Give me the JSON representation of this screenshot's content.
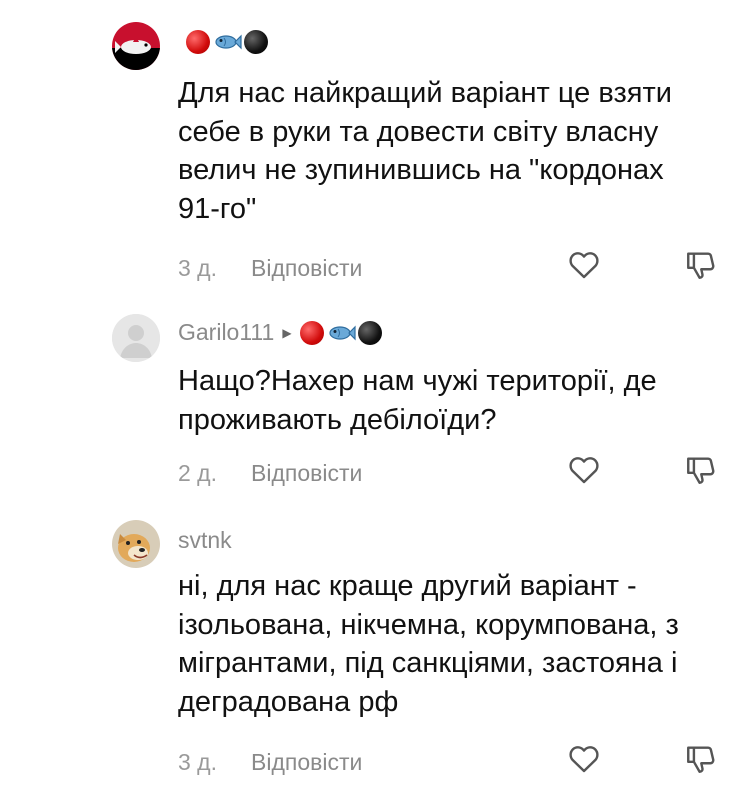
{
  "comments": [
    {
      "username": "",
      "flair": [
        "red-circle",
        "fish",
        "black-circle"
      ],
      "text": "Для нас найкращий варіант це взяти\nсебе в руки та довести світу власну\nвелич не зупинившись на \"кордонах\n91-го\"",
      "time": "3 д.",
      "reply_label": "Відповісти"
    },
    {
      "username": "Garilo111",
      "reply_to_arrow": "▶",
      "flair": [
        "red-circle",
        "fish",
        "black-circle"
      ],
      "text": "Нащо?Нахер нам чужі території, де\nпроживають дебілоїди?",
      "time": "2 д.",
      "reply_label": "Відповісти"
    },
    {
      "username": "svtnk",
      "text": "ні, для нас краще другий варіант -\nізольована, нікчемна, корумпована, з\nмігрантами, під санкціями, застояна і\nдеградована рф",
      "time": "3 д.",
      "reply_label": "Відповісти"
    }
  ],
  "colors": {
    "meta": "#9a9a9a",
    "username": "#8a8a8a",
    "text": "#111111"
  }
}
